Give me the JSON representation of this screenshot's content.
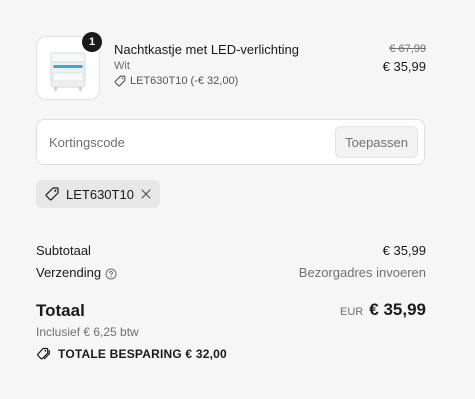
{
  "product": {
    "quantity": "1",
    "name": "Nachtkastje met LED-verlichting",
    "variant": "Wit",
    "discount_line": "LET630T10 (-€ 32,00)",
    "compare_price": "€ 67,99",
    "price": "€ 35,99"
  },
  "discount_field": {
    "placeholder": "Kortingscode",
    "apply_label": "Toepassen"
  },
  "applied_code": {
    "code": "LET630T10"
  },
  "summary": {
    "subtotal_label": "Subtotaal",
    "subtotal_value": "€ 35,99",
    "shipping_label": "Verzending",
    "shipping_value": "Bezorgadres invoeren",
    "total_label": "Totaal",
    "total_currency": "EUR",
    "total_value": "€ 35,99",
    "vat_text": "Inclusief € 6,25 btw",
    "savings_text": "TOTALE BESPARING € 32,00"
  },
  "icons": {
    "discount_tag": "tag-icon",
    "remove": "close-icon",
    "help": "question-circle-icon",
    "savings": "tags-icon"
  }
}
